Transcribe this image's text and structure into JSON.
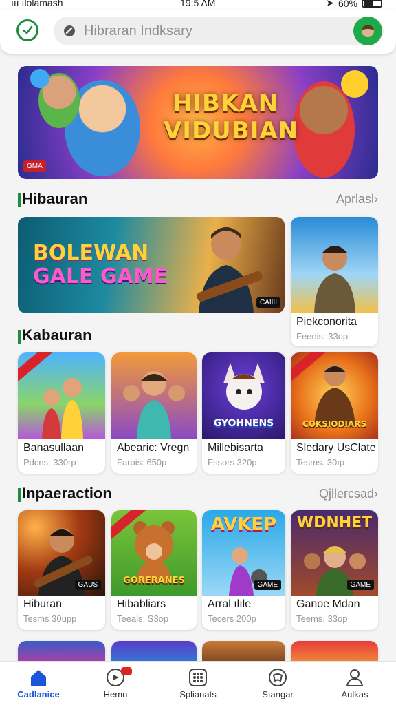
{
  "status_bar": {
    "left": "ııı ılolamash",
    "time": "19:5 ΛΜ",
    "battery": "60%"
  },
  "header": {
    "search_placeholder": "Hibraran Indksary"
  },
  "banner": {
    "title_line1": "HIBKAN",
    "title_line2": "VIDUBIAN",
    "tag": "GMA"
  },
  "section_1": {
    "title": "Hibauran",
    "more": "Aprlasl›"
  },
  "featured": {
    "big_logo_line1": "BOLEWAN",
    "big_logo_line2": "GALE GAME",
    "big_badge": "CAIIII",
    "side_card": {
      "name": "Piekconorita",
      "sub": "Feenis: 33op"
    }
  },
  "section_2": {
    "title": "Kabauran"
  },
  "row_2": [
    {
      "name": "Banasullaan",
      "sub": "Pdcns: 330rp",
      "label": ""
    },
    {
      "name": "Abearic: Vregn",
      "sub": "Farois: 650p",
      "label": ""
    },
    {
      "name": "Millebisarta",
      "sub": "Fssors 320p",
      "label": "GYOHNENS"
    },
    {
      "name": "Sledary UsClate",
      "sub": "Tesms. 30ıp",
      "label": "COKSIODIARS"
    }
  ],
  "section_3": {
    "title": "Inpaeraction",
    "more": "Qjllercsad›"
  },
  "row_3": [
    {
      "name": "Hiburan",
      "sub": "Tesms 30upp",
      "label": "",
      "badge": "GAUS"
    },
    {
      "name": "Hibabliars",
      "sub": "Teeals: S3op",
      "label": "GORERANES",
      "badge": ""
    },
    {
      "name": "Arral ılıle",
      "sub": "Tecers 200p",
      "label": "AVKEP",
      "badge": "GAME"
    },
    {
      "name": "Ganoe Mdan",
      "sub": "Teems. 33op",
      "label": "WDNHET",
      "badge": "GAME"
    }
  ],
  "bottom_nav": [
    {
      "label": "Cadlanice"
    },
    {
      "label": "Hemn"
    },
    {
      "label": "Splianats"
    },
    {
      "label": "Sıangar"
    },
    {
      "label": "Aulkas"
    }
  ],
  "colors": {
    "accent_green": "#1e8e3e",
    "active_blue": "#1a56d8",
    "badge_red": "#e02424"
  }
}
